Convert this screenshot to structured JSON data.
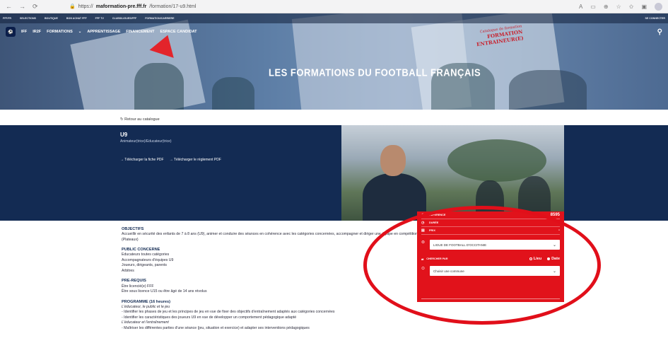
{
  "browser": {
    "url_prefix": "https://",
    "url_host": "maformation-pre.fff.fr",
    "url_path": "/formation/17-u9.html"
  },
  "site": {
    "topbar_links": [
      "FFF.FR",
      "SELECTIONS",
      "BOUTIQUE",
      "BON ACHAT FFF",
      "FFF TV",
      "CLUBS/LIGUES/FFF",
      "FORMATION/CARRIERE"
    ],
    "topbar_right": "SE CONNECTER",
    "nav_items": [
      "IFF",
      "IR2F",
      "FORMATIONS",
      "APPRENTISSAGE",
      "FINANCEMENT",
      "ESPACE CANDIDAT"
    ],
    "hero_title": "LES FORMATIONS DU FOOTBALL FRANÇAIS",
    "catalog_line1": "Catalogue de formation",
    "catalog_line2": "FORMATION ENTRAINEUR(E)"
  },
  "page": {
    "back_link": "Retour au catalogue",
    "course_code": "U9",
    "course_role": "Animateur(trice)/Educateur(trice)",
    "download_sheet": "→ Télécharger la fiche PDF",
    "download_rules": "→ Télécharger le règlement PDF"
  },
  "content": {
    "objectives_title": "OBJECTIFS",
    "objectives_text": "Accueillir en sécurité des enfants de 7 à 8 ans (U9), animer et conduire des séances en cohérence avec les catégories concernées, accompagner et diriger une équipe en compétition (Plateaux)",
    "public_title": "PUBLIC CONCERNE",
    "public_items": [
      "Educateurs toutes catégories",
      "Accompagnateurs d'équipes U9",
      "Joueurs, dirigeants, parents",
      "Arbitres"
    ],
    "prereq_title": "PRE-REQUIS",
    "prereq_items": [
      "Être licencié(e) FFF",
      "Être sous licence U15 ou être âgé de 14 ans révolus"
    ],
    "program_title": "PROGRAMME (16 heures)",
    "program_sub1": "L'éducateur, le public et le jeu",
    "program_item1": "- Identifier les phases de jeu et les principes de jeu en vue de fixer des objectifs d'entraînement adaptés aux catégories concernées",
    "program_item2": "- Identifier les caractéristiques des joueurs U9 en vue de développer un comportement pédagogique adapté",
    "program_sub2": "L'éducateur et l'entraînement",
    "program_item3": "- Maîtriser les différentes parties d'une séance (jeu, situation et exercice) et adapter ses interventions pédagogiques"
  },
  "panel": {
    "reference_label": "RÉFÉRENCE",
    "reference_value": "8595",
    "duration_label": "DURÉE",
    "duration_value": "-",
    "price_label": "PRIX",
    "price_value": "-",
    "league_select": "LIGUE DE FOOTBALL D'OCCITANIE",
    "search_by_label": "CHERCHER PAR",
    "option_place": "Lieu",
    "option_date": "Date",
    "commune_placeholder": "Choisir une commune"
  }
}
